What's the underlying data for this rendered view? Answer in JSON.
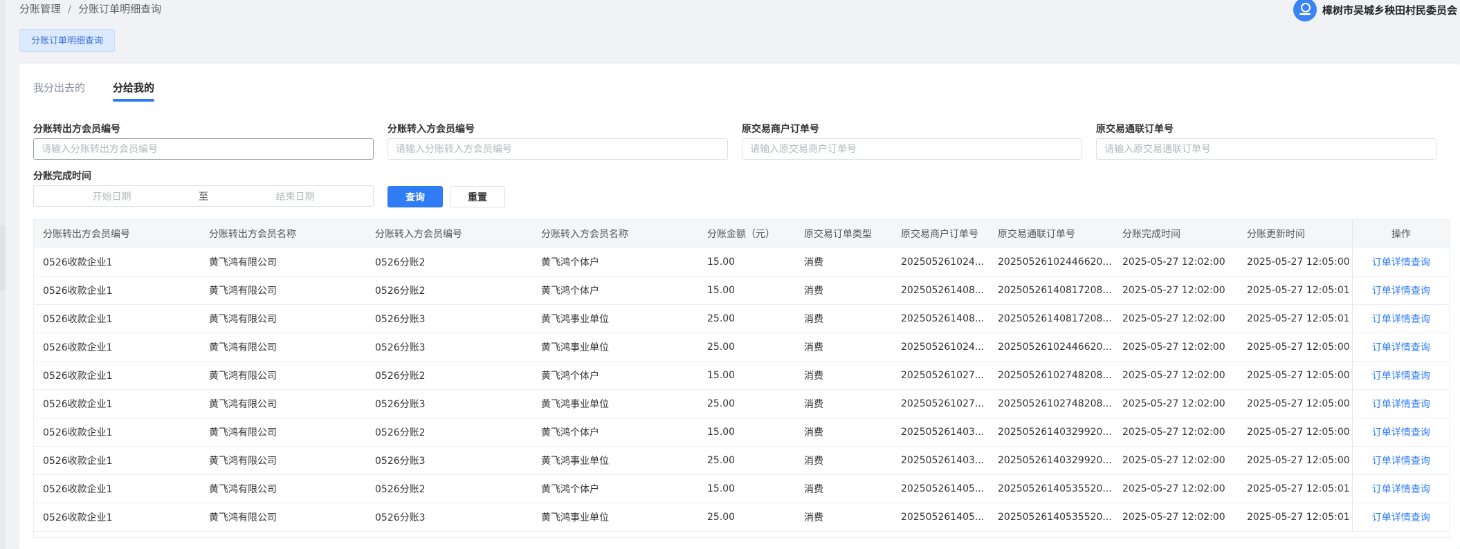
{
  "breadcrumb": {
    "parent": "分账管理",
    "sep": "/",
    "current": "分账订单明细查询"
  },
  "user": {
    "name": "樟树市吴城乡秧田村民委员会"
  },
  "page_tag": "分账订单明细查询",
  "tabs": [
    {
      "label": "我分出去的",
      "active": false
    },
    {
      "label": "分给我的",
      "active": true
    }
  ],
  "filters": {
    "out_member_no": {
      "label": "分账转出方会员编号",
      "placeholder": "请输入分账转出方会员编号",
      "value": ""
    },
    "in_member_no": {
      "label": "分账转入方会员编号",
      "placeholder": "请输入分账转入方会员编号",
      "value": ""
    },
    "merchant_order": {
      "label": "原交易商户订单号",
      "placeholder": "请输入原交易商户订单号",
      "value": ""
    },
    "union_order": {
      "label": "原交易通联订单号",
      "placeholder": "请输入原交易通联订单号",
      "value": ""
    },
    "complete_time": {
      "label": "分账完成时间",
      "start_placeholder": "开始日期",
      "to": "至",
      "end_placeholder": "结束日期"
    },
    "query_label": "查询",
    "reset_label": "重置"
  },
  "table": {
    "headers": [
      "分账转出方会员编号",
      "分账转出方会员名称",
      "分账转入方会员编号",
      "分账转入方会员名称",
      "分账金额（元）",
      "原交易订单类型",
      "原交易商户订单号",
      "原交易通联订单号",
      "分账完成时间",
      "分账更新时间",
      "操作"
    ],
    "rows": [
      [
        "0526收款企业1",
        "黄飞鸿有限公司",
        "0526分账2",
        "黄飞鸿个体户",
        "15.00",
        "消费",
        "202505261024...",
        "20250526102446620...",
        "2025-05-27 12:02:00",
        "2025-05-27 12:05:00",
        "订单详情查询"
      ],
      [
        "0526收款企业1",
        "黄飞鸿有限公司",
        "0526分账2",
        "黄飞鸿个体户",
        "15.00",
        "消费",
        "202505261408...",
        "20250526140817208...",
        "2025-05-27 12:02:00",
        "2025-05-27 12:05:01",
        "订单详情查询"
      ],
      [
        "0526收款企业1",
        "黄飞鸿有限公司",
        "0526分账3",
        "黄飞鸿事业单位",
        "25.00",
        "消费",
        "202505261408...",
        "20250526140817208...",
        "2025-05-27 12:02:00",
        "2025-05-27 12:05:01",
        "订单详情查询"
      ],
      [
        "0526收款企业1",
        "黄飞鸿有限公司",
        "0526分账3",
        "黄飞鸿事业单位",
        "25.00",
        "消费",
        "202505261024...",
        "20250526102446620...",
        "2025-05-27 12:02:00",
        "2025-05-27 12:05:00",
        "订单详情查询"
      ],
      [
        "0526收款企业1",
        "黄飞鸿有限公司",
        "0526分账2",
        "黄飞鸿个体户",
        "15.00",
        "消费",
        "202505261027...",
        "20250526102748208...",
        "2025-05-27 12:02:00",
        "2025-05-27 12:05:00",
        "订单详情查询"
      ],
      [
        "0526收款企业1",
        "黄飞鸿有限公司",
        "0526分账3",
        "黄飞鸿事业单位",
        "25.00",
        "消费",
        "202505261027...",
        "20250526102748208...",
        "2025-05-27 12:02:00",
        "2025-05-27 12:05:00",
        "订单详情查询"
      ],
      [
        "0526收款企业1",
        "黄飞鸿有限公司",
        "0526分账2",
        "黄飞鸿个体户",
        "15.00",
        "消费",
        "202505261403...",
        "20250526140329920...",
        "2025-05-27 12:02:00",
        "2025-05-27 12:05:00",
        "订单详情查询"
      ],
      [
        "0526收款企业1",
        "黄飞鸿有限公司",
        "0526分账3",
        "黄飞鸿事业单位",
        "25.00",
        "消费",
        "202505261403...",
        "20250526140329920...",
        "2025-05-27 12:02:00",
        "2025-05-27 12:05:00",
        "订单详情查询"
      ],
      [
        "0526收款企业1",
        "黄飞鸿有限公司",
        "0526分账2",
        "黄飞鸿个体户",
        "15.00",
        "消费",
        "202505261405...",
        "20250526140535520...",
        "2025-05-27 12:02:00",
        "2025-05-27 12:05:01",
        "订单详情查询"
      ],
      [
        "0526收款企业1",
        "黄飞鸿有限公司",
        "0526分账3",
        "黄飞鸿事业单位",
        "25.00",
        "消费",
        "202505261405...",
        "20250526140535520...",
        "2025-05-27 12:02:00",
        "2025-05-27 12:05:01",
        "订单详情查询"
      ]
    ]
  },
  "colors": {
    "primary": "#2f7cf6",
    "link": "#2d7cf6",
    "tag_bg": "#dbeafe",
    "page_bg": "#f0f2f5"
  }
}
